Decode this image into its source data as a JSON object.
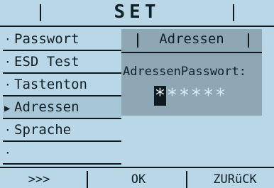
{
  "screen": {
    "title": "SET",
    "menu": {
      "items": [
        {
          "label": "Passwort",
          "bullet": "·"
        },
        {
          "label": "ESD Test",
          "bullet": "·"
        },
        {
          "label": "Tastenton",
          "bullet": "·"
        },
        {
          "label": "Adressen",
          "bullet": "▶",
          "selected": true
        },
        {
          "label": "Sprache",
          "bullet": "·"
        },
        {
          "label": "",
          "bullet": "·"
        }
      ]
    },
    "panel": {
      "title": "Adressen",
      "field_label": "AdressenPasswort:",
      "password_chars": [
        "*",
        "*",
        "*",
        "*",
        "*",
        "*"
      ]
    },
    "softkeys": {
      "left": ">>>",
      "middle": "OK",
      "right": "ZURüCK"
    },
    "colors": {
      "background": "#b9d7e6",
      "panel": "#8da7b5",
      "ink": "#0e1a22",
      "selected": "#a7c6d6"
    }
  }
}
